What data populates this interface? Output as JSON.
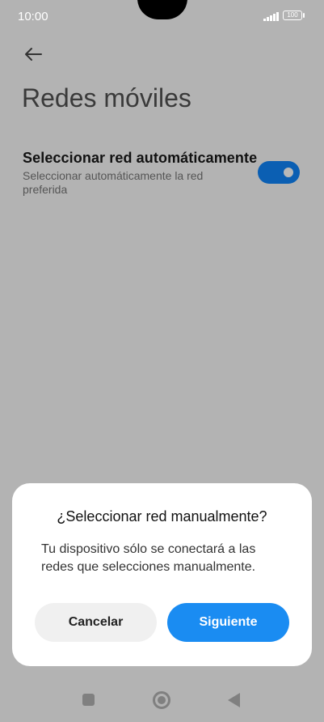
{
  "status_bar": {
    "time": "10:00",
    "battery": "100",
    "signal_icon": "signal-bars-icon",
    "battery_icon": "battery-icon"
  },
  "header": {
    "back_icon": "arrow-left-icon",
    "title": "Redes móviles"
  },
  "setting": {
    "title": "Seleccionar red automáticamente",
    "subtitle": "Seleccionar automáticamente la red preferida",
    "toggle_on": true
  },
  "dialog": {
    "title": "¿Seleccionar red manualmente?",
    "message": "Tu dispositivo sólo se conectará a las redes que selecciones manualmente.",
    "cancel_label": "Cancelar",
    "next_label": "Siguiente"
  },
  "nav_bar": {
    "icons": [
      "recents-square-icon",
      "home-circle-icon",
      "back-triangle-icon"
    ]
  },
  "colors": {
    "accent": "#1a8cf2",
    "toggle": "#0b5fb3",
    "overlay_background": "#b3b3b3"
  }
}
